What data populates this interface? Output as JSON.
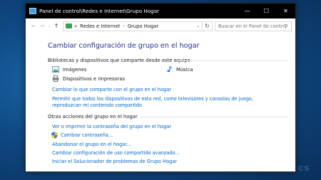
{
  "window": {
    "title": "Panel de control\\Redes e Internet\\Grupo Hogar",
    "minimize_symbol": "—",
    "maximize_symbol": "☐",
    "close_symbol": "✕"
  },
  "nav": {
    "back_symbol": "←",
    "forward_symbol": "→",
    "recent_symbol": "⌄",
    "up_symbol": "↑",
    "path_prefix": "«",
    "breadcrumb": [
      "Redes e Internet",
      "Grupo Hogar"
    ],
    "breadcrumb_sep": "›",
    "path_dropdown": "⌄",
    "refresh_symbol": "↻",
    "search_placeholder": "Buscar en el Panel de control",
    "search_symbol": "⚲"
  },
  "main": {
    "title": "Cambiar configuración de grupo en el hogar",
    "libraries_heading": "Bibliotecas y dispositivos que comparte desde este equipo",
    "shared_items": [
      {
        "label": "Imágenes",
        "icon": "pictures-icon"
      },
      {
        "label": "Música",
        "icon": "music-icon"
      },
      {
        "label": "Dispositivos e impresoras",
        "icon": "printer-icon"
      }
    ],
    "share_links": [
      "Cambiar lo que comparte con el grupo en el hogar",
      "Permitir que todos los dispositivos de esta red, como televisores y consolas de juego, reproduzcan mi contenido compartido"
    ],
    "other_heading": "Otras acciones del grupo en el hogar",
    "other_links": [
      "Ver o imprimir la contraseña del grupo en el hogar",
      "Cambiar contraseña...",
      "Abandonar el grupo en el hogar...",
      "Cambiar configuración de uso compartido avanzado...",
      "Iniciar el Solucionador de problemas de Grupo Hogar"
    ]
  },
  "watermark": "CS",
  "colors": {
    "title_blue": "#1e3287",
    "link_blue": "#0066cc",
    "desktop_blue": "#0f4a85"
  }
}
